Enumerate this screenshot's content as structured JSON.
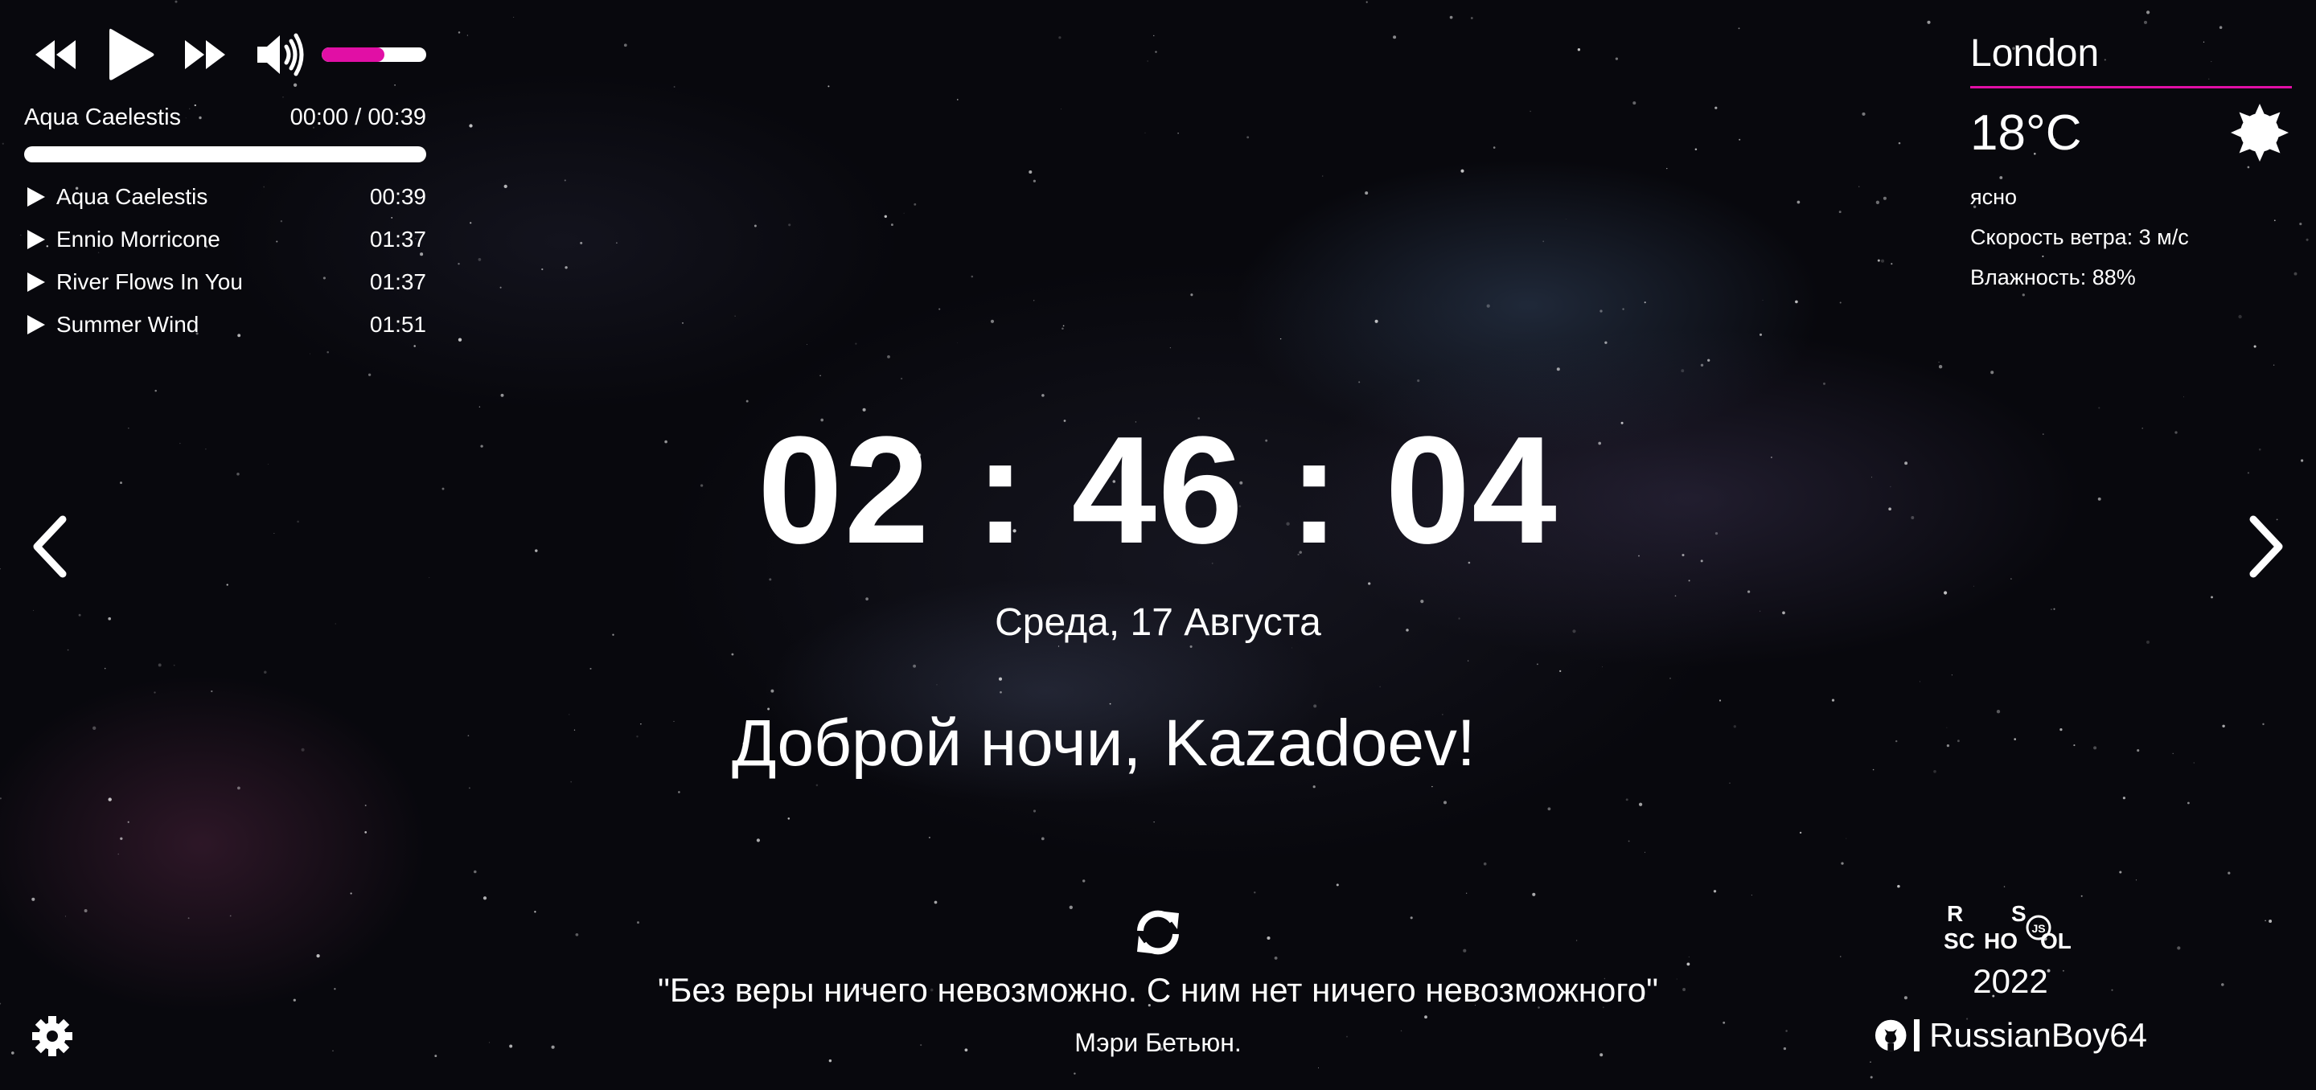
{
  "player": {
    "current_track": "Aqua Caelestis",
    "time": "00:00 / 00:39",
    "progress_fraction": 0,
    "volume_fraction": 0.6,
    "playlist": [
      {
        "title": "Aqua Caelestis",
        "duration": "00:39"
      },
      {
        "title": "Ennio Morricone",
        "duration": "01:37"
      },
      {
        "title": "River Flows In You",
        "duration": "01:37"
      },
      {
        "title": "Summer Wind",
        "duration": "01:51"
      }
    ]
  },
  "weather": {
    "city": "London",
    "temperature": "18°C",
    "description": "ясно",
    "wind": "Скорость ветра: 3 м/с",
    "humidity": "Влажность: 88%",
    "icon": "clear-sky-icon"
  },
  "clock": {
    "time": "02 : 46 : 04",
    "date": "Среда, 17 Августа"
  },
  "greeting": {
    "text": "Доброй ночи,",
    "name": "Kazadoev!"
  },
  "quote": {
    "text": "\"Без веры ничего невозможно. С ним нет ничего невозможного\"",
    "author": "Мэри Бетьюн."
  },
  "footer": {
    "year": "2022",
    "github_user": "RussianBoy64",
    "logo_text": [
      "R",
      "S",
      "SC",
      "HO",
      "OL",
      "JS"
    ]
  },
  "colors": {
    "accent": "#e10fa5",
    "text": "#ffffff",
    "background": "#08080d"
  }
}
